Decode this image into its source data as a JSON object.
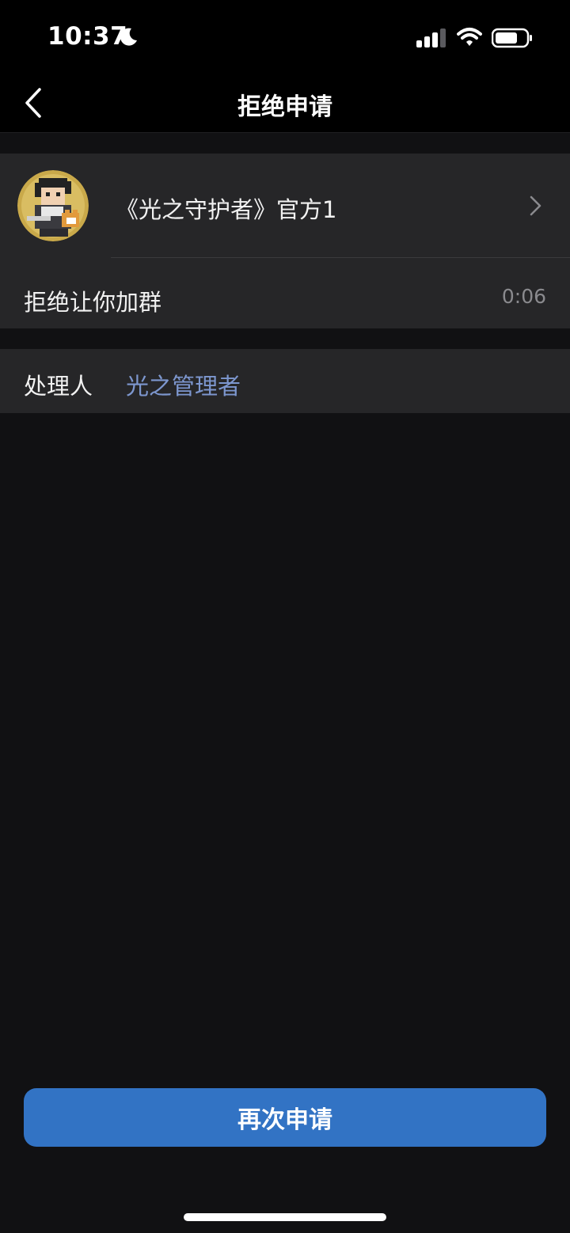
{
  "status_bar": {
    "time": "10:37",
    "icons": [
      "moon-icon",
      "signal-icon",
      "wifi-icon",
      "battery-icon"
    ]
  },
  "nav": {
    "title": "拒绝申请",
    "back_icon": "chevron-left-icon"
  },
  "group": {
    "name": "《光之守护者》官方1",
    "avatar_icon": "pixel-character-avatar",
    "chevron_icon": "chevron-right-icon"
  },
  "reason": {
    "text": "拒绝让你加群",
    "time": "0:06"
  },
  "handler": {
    "label": "处理人",
    "name": "光之管理者"
  },
  "actions": {
    "reapply_label": "再次申请"
  },
  "colors": {
    "background": "#111113",
    "card": "#262628",
    "accent_button": "#3273c4",
    "link": "#7d97cf",
    "secondary_text": "#8a8a8e"
  }
}
